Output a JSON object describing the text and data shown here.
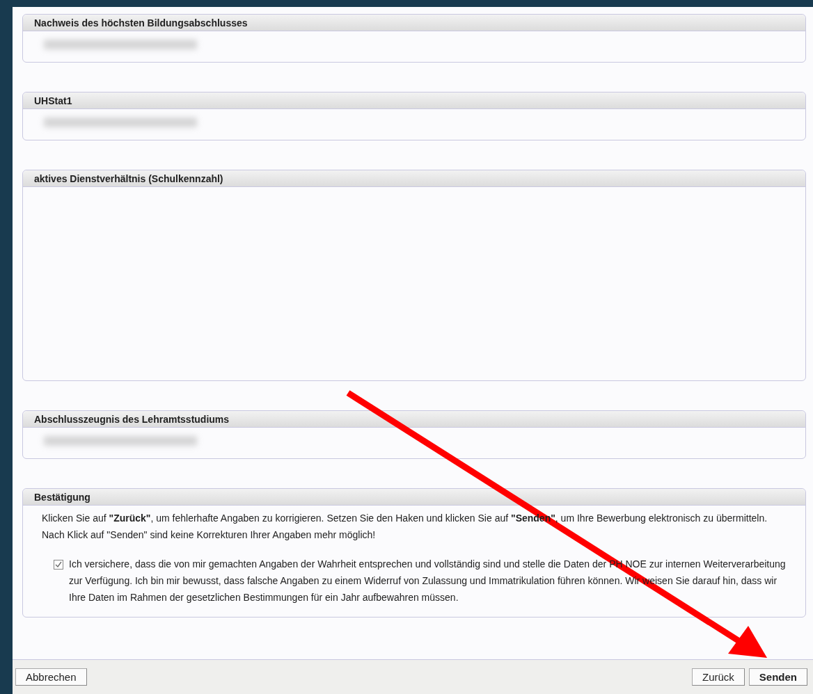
{
  "sections": [
    {
      "kind": "document",
      "title": "Nachweis des höchsten Bildungsabschlusses"
    },
    {
      "kind": "document",
      "title": "UHStat1"
    },
    {
      "kind": "empty",
      "title": "aktives Dienstverhältnis (Schulkennzahl)"
    },
    {
      "kind": "document",
      "title": "Abschlusszeugnis des Lehramtsstudiums"
    }
  ],
  "confirmation": {
    "title": "Bestätigung",
    "instructions": " Klicken Sie auf **\"Zurück\"**, um fehlerhafte Angaben zu korrigieren. Setzen Sie den Haken und klicken Sie auf **\"Senden\"**, um Ihre Bewerbung elektronisch zu übermitteln. Nach Klick auf \"Senden\" sind keine Korrekturen Ihrer Angaben mehr möglich!",
    "declaration": {
      "checked": true,
      "label": "Ich versichere, dass die von mir gemachten Angaben der Wahrheit entsprechen und vollständig sind und stelle die Daten der PH NOE zur internen Weiterverarbeitung zur Verfügung. Ich bin mir bewusst, dass falsche Angaben zu einem Widerruf von Zulassung und Immatrikulation führen können. Wir weisen Sie darauf hin, dass wir Ihre Daten im Rahmen der gesetzlichen Bestimmungen für ein Jahr aufbewahren müssen."
    }
  },
  "footer": {
    "cancel": "Abbrechen",
    "back": "Zurück",
    "send": "Senden"
  }
}
